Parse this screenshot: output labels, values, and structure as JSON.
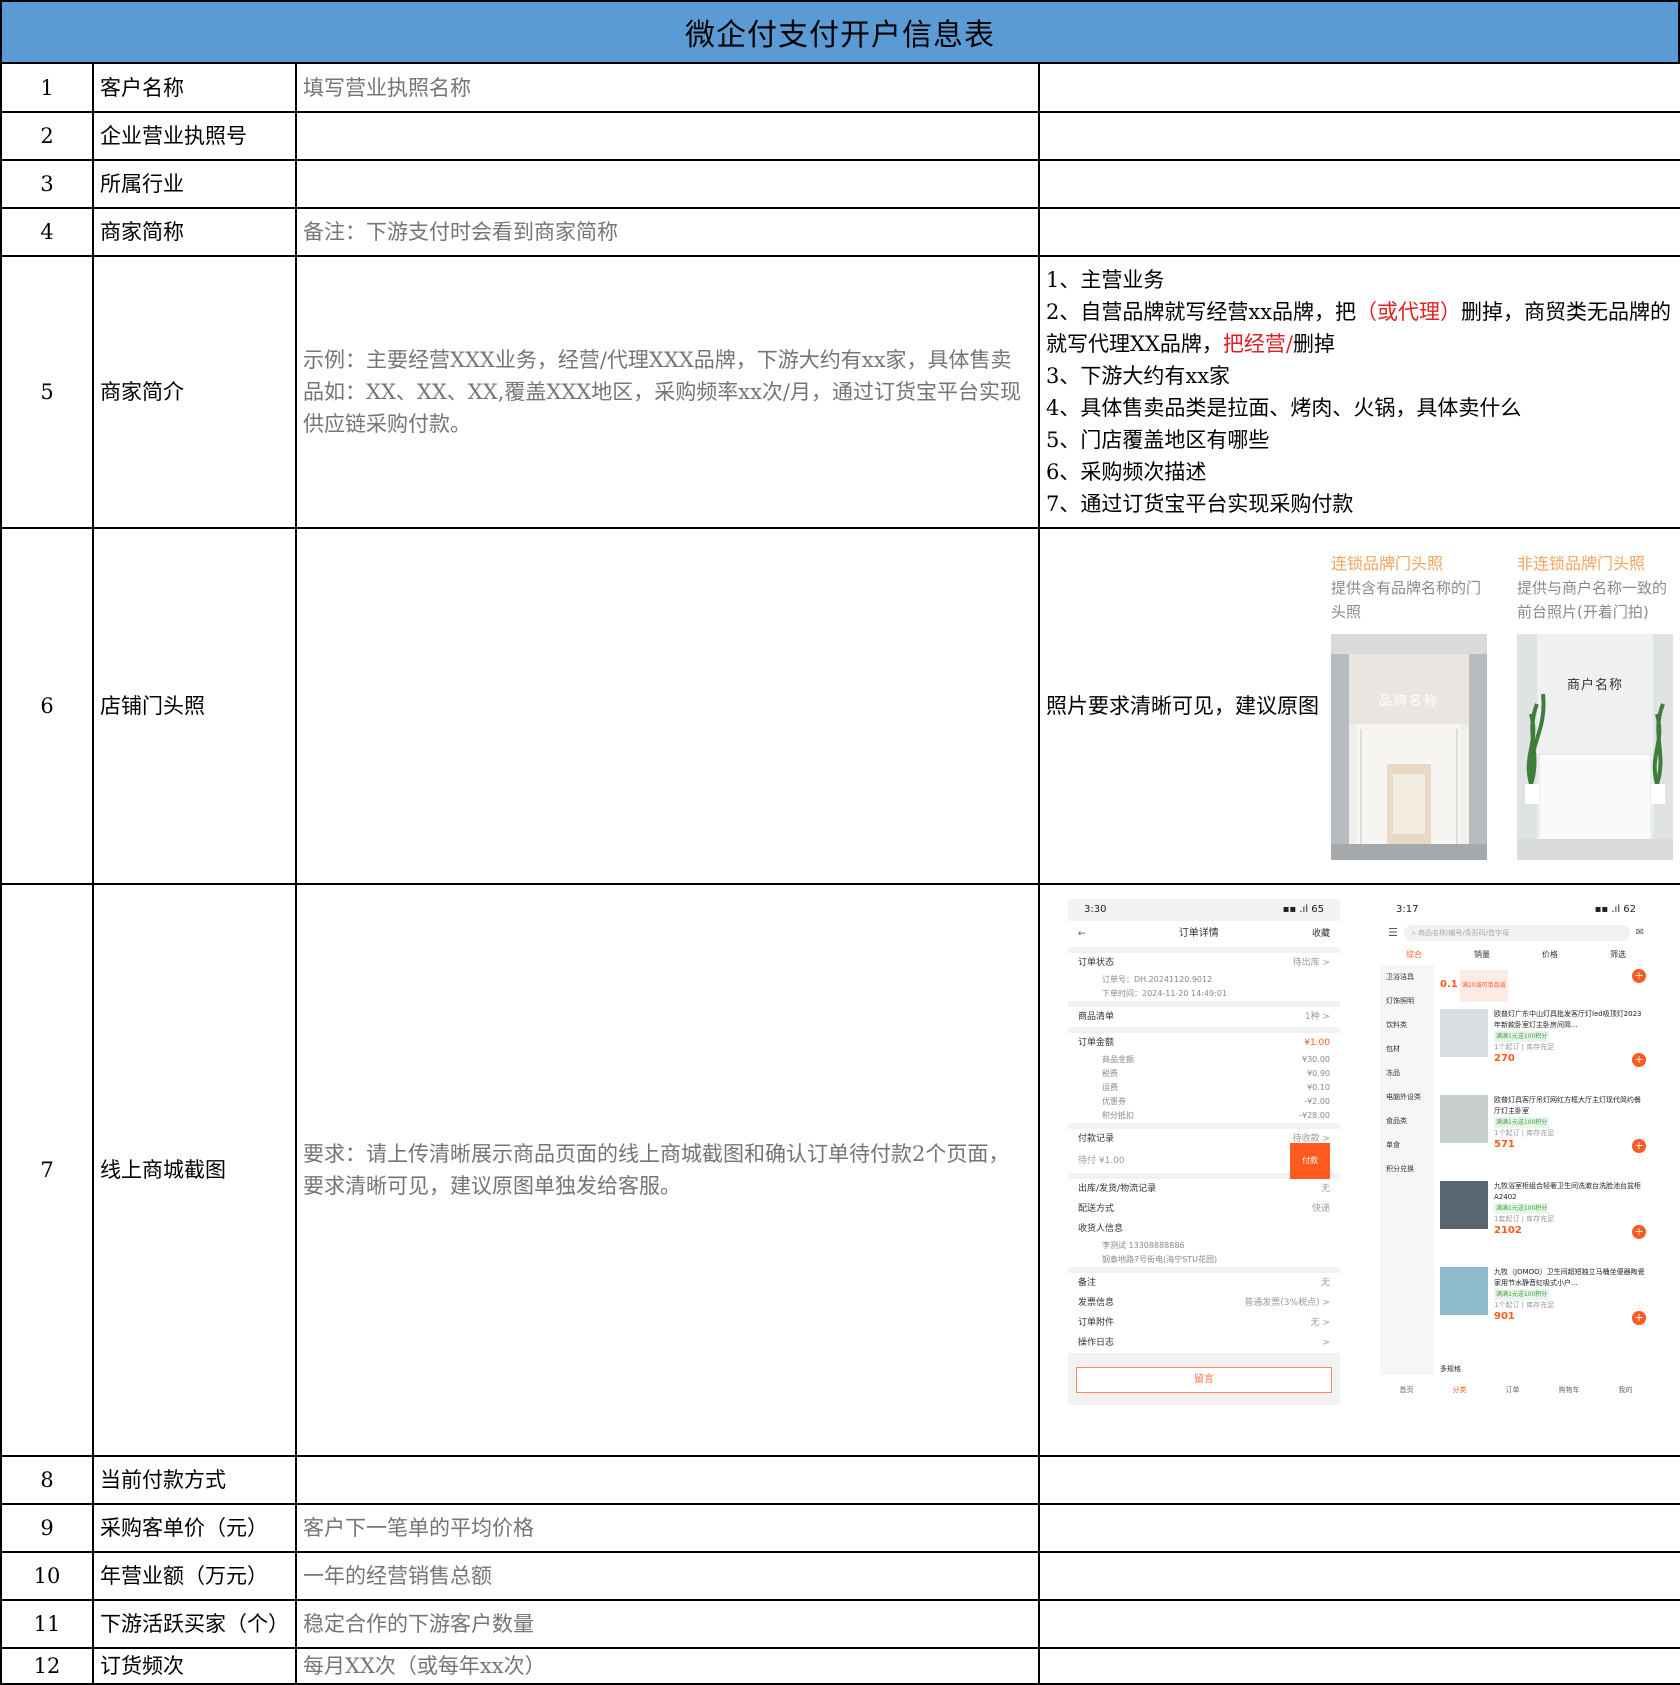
{
  "title": "微企付支付开户信息表",
  "rows": [
    {
      "num": "1",
      "label": "客户名称",
      "hint": "填写营业执照名称",
      "note": ""
    },
    {
      "num": "2",
      "label": "企业营业执照号",
      "hint": "",
      "note": ""
    },
    {
      "num": "3",
      "label": "所属行业",
      "hint": "",
      "note": ""
    },
    {
      "num": "4",
      "label": "商家简称",
      "hint": "备注：下游支付时会看到商家简称",
      "note": ""
    },
    {
      "num": "5",
      "label": "商家简介",
      "hint": "示例：主要经营XXX业务，经营/代理XXX品牌，下游大约有xx家，具体售卖品如：XX、XX、XX,覆盖XXX地区，采购频率xx次/月，通过订货宝平台实现供应链采购付款。"
    },
    {
      "num": "6",
      "label": "店铺门头照",
      "hint": "",
      "note": "照片要求清晰可见，建议原图"
    },
    {
      "num": "7",
      "label": "线上商城截图",
      "hint": "要求：请上传清晰展示商品页面的线上商城截图和确认订单待付款2个页面，要求清晰可见，建议原图单独发给客服。"
    },
    {
      "num": "8",
      "label": "当前付款方式",
      "hint": "",
      "note": ""
    },
    {
      "num": "9",
      "label": "采购客单价（元）",
      "hint": "客户下一笔单的平均价格",
      "note": ""
    },
    {
      "num": "10",
      "label": "年营业额（万元）",
      "hint": "一年的经营销售总额",
      "note": ""
    },
    {
      "num": "11",
      "label": "下游活跃买家（个）",
      "hint": "稳定合作的下游客户数量",
      "note": ""
    },
    {
      "num": "12",
      "label": "订货频次",
      "hint": "每月XX次（或每年xx次）",
      "note": ""
    }
  ],
  "row5_notes": {
    "l1": "1、主营业务",
    "l2a": "2、自营品牌就写经营xx品牌，把",
    "l2b": "（或代理）",
    "l2c": "删掉，商贸类无品牌的",
    "l3a": "就写代理XX品牌，",
    "l3b": "把经营/",
    "l3c": "删掉",
    "l4": "3、下游大约有xx家",
    "l5": "4、具体售卖品类是拉面、烤肉、火锅，具体卖什么",
    "l6": "5、门店覆盖地区有哪些",
    "l7": "6、采购频次描述",
    "l8": "7、通过订货宝平台实现采购付款"
  },
  "row6_examples": {
    "chain_title": "连锁品牌门头照",
    "chain_desc": "提供含有品牌名称的门头照",
    "chain_sign": "品牌名称",
    "nonchain_title": "非连锁品牌门头照",
    "nonchain_desc": "提供与商户名称一致的前台照片(开着门拍)",
    "nonchain_sign": "商户名称"
  },
  "phone_order": {
    "time": "3:30",
    "status_icons": "▪▪ .ıl 65",
    "title": "订单详情",
    "fav": "收藏",
    "order_status": "订单状态",
    "order_status_val": "待出库 >",
    "order_no": "订单号：DH.20241120.9012",
    "order_time": "下单时间：2024-11-20 14:49:01",
    "goods": "商品清单",
    "goods_val": "1种 >",
    "amount": "订单金额",
    "amount_val": "¥1.00",
    "lines": [
      {
        "k": "商品金额",
        "v": "¥30.00"
      },
      {
        "k": "税费",
        "v": "¥0.90"
      },
      {
        "k": "运费",
        "v": "¥0.10"
      },
      {
        "k": "优惠券",
        "v": "-¥2.00"
      },
      {
        "k": "积分抵扣",
        "v": "-¥28.00"
      }
    ],
    "pay_record": "付款记录",
    "pay_record_val": "待收款 >",
    "pending": "待付 ¥1.00",
    "pay_btn": "付款",
    "logistics": "出库/发货/物流记录",
    "logistics_val": "无",
    "delivery": "配送方式",
    "delivery_val": "快递",
    "receiver": "收货人信息",
    "receiver_name": "李测试   13308888886",
    "receiver_addr": "钢泰地路7号街电(海宁STU花园)",
    "remark": "备注",
    "remark_val": "无",
    "invoice": "发票信息",
    "invoice_val": "普通发票(3%税点) >",
    "attach": "订单附件",
    "attach_val": "无 >",
    "log": "操作日志",
    "log_val": ">",
    "msg_btn": "留言"
  },
  "phone_shop": {
    "time": "3:17",
    "status_icons": "▪▪ .ıl 62",
    "search": "商品名称/编号/条形码/首字母",
    "tabs": [
      "综合",
      "销量",
      "价格",
      "筛选"
    ],
    "cats": [
      "卫浴洁具",
      "灯饰照明",
      "饮料类",
      "包材",
      "冻品",
      "电脑外设类",
      "食品类",
      "单食",
      "积分兑换"
    ],
    "top_price": "0.1",
    "top_tag": "满20减可单品减",
    "products": [
      {
        "name": "欧普灯广东中山灯具批发客厅灯led吸顶灯2023年新款卧室灯主卧房间简...",
        "tag": "满满1元送100积分",
        "sub": "1个起订 | 库存充足",
        "price": "270"
      },
      {
        "name": "欧普灯具客厅吊灯网红方框大厅主灯现代简约餐厅灯主卧室",
        "tag": "满满1元送100积分",
        "sub": "1个起订 | 库存充足",
        "price": "571"
      },
      {
        "name": "九牧浴室柜组合轻奢卫生间洗漱台洗脸池台盆柜A2402",
        "tag": "满满1元送100积分",
        "sub": "1套起订 | 库存充足",
        "price": "2102"
      },
      {
        "name": "九牧（JOMOO）卫生间超短独立马桶坐便器陶瓷家用节水静音虹吸式小户...",
        "tag": "满满1元送100积分",
        "sub": "1个起订 | 库存充足",
        "price": "901"
      }
    ],
    "more": "多规格",
    "bottom_tabs": [
      "首页",
      "分类",
      "订单",
      "购物车",
      "我的"
    ]
  }
}
